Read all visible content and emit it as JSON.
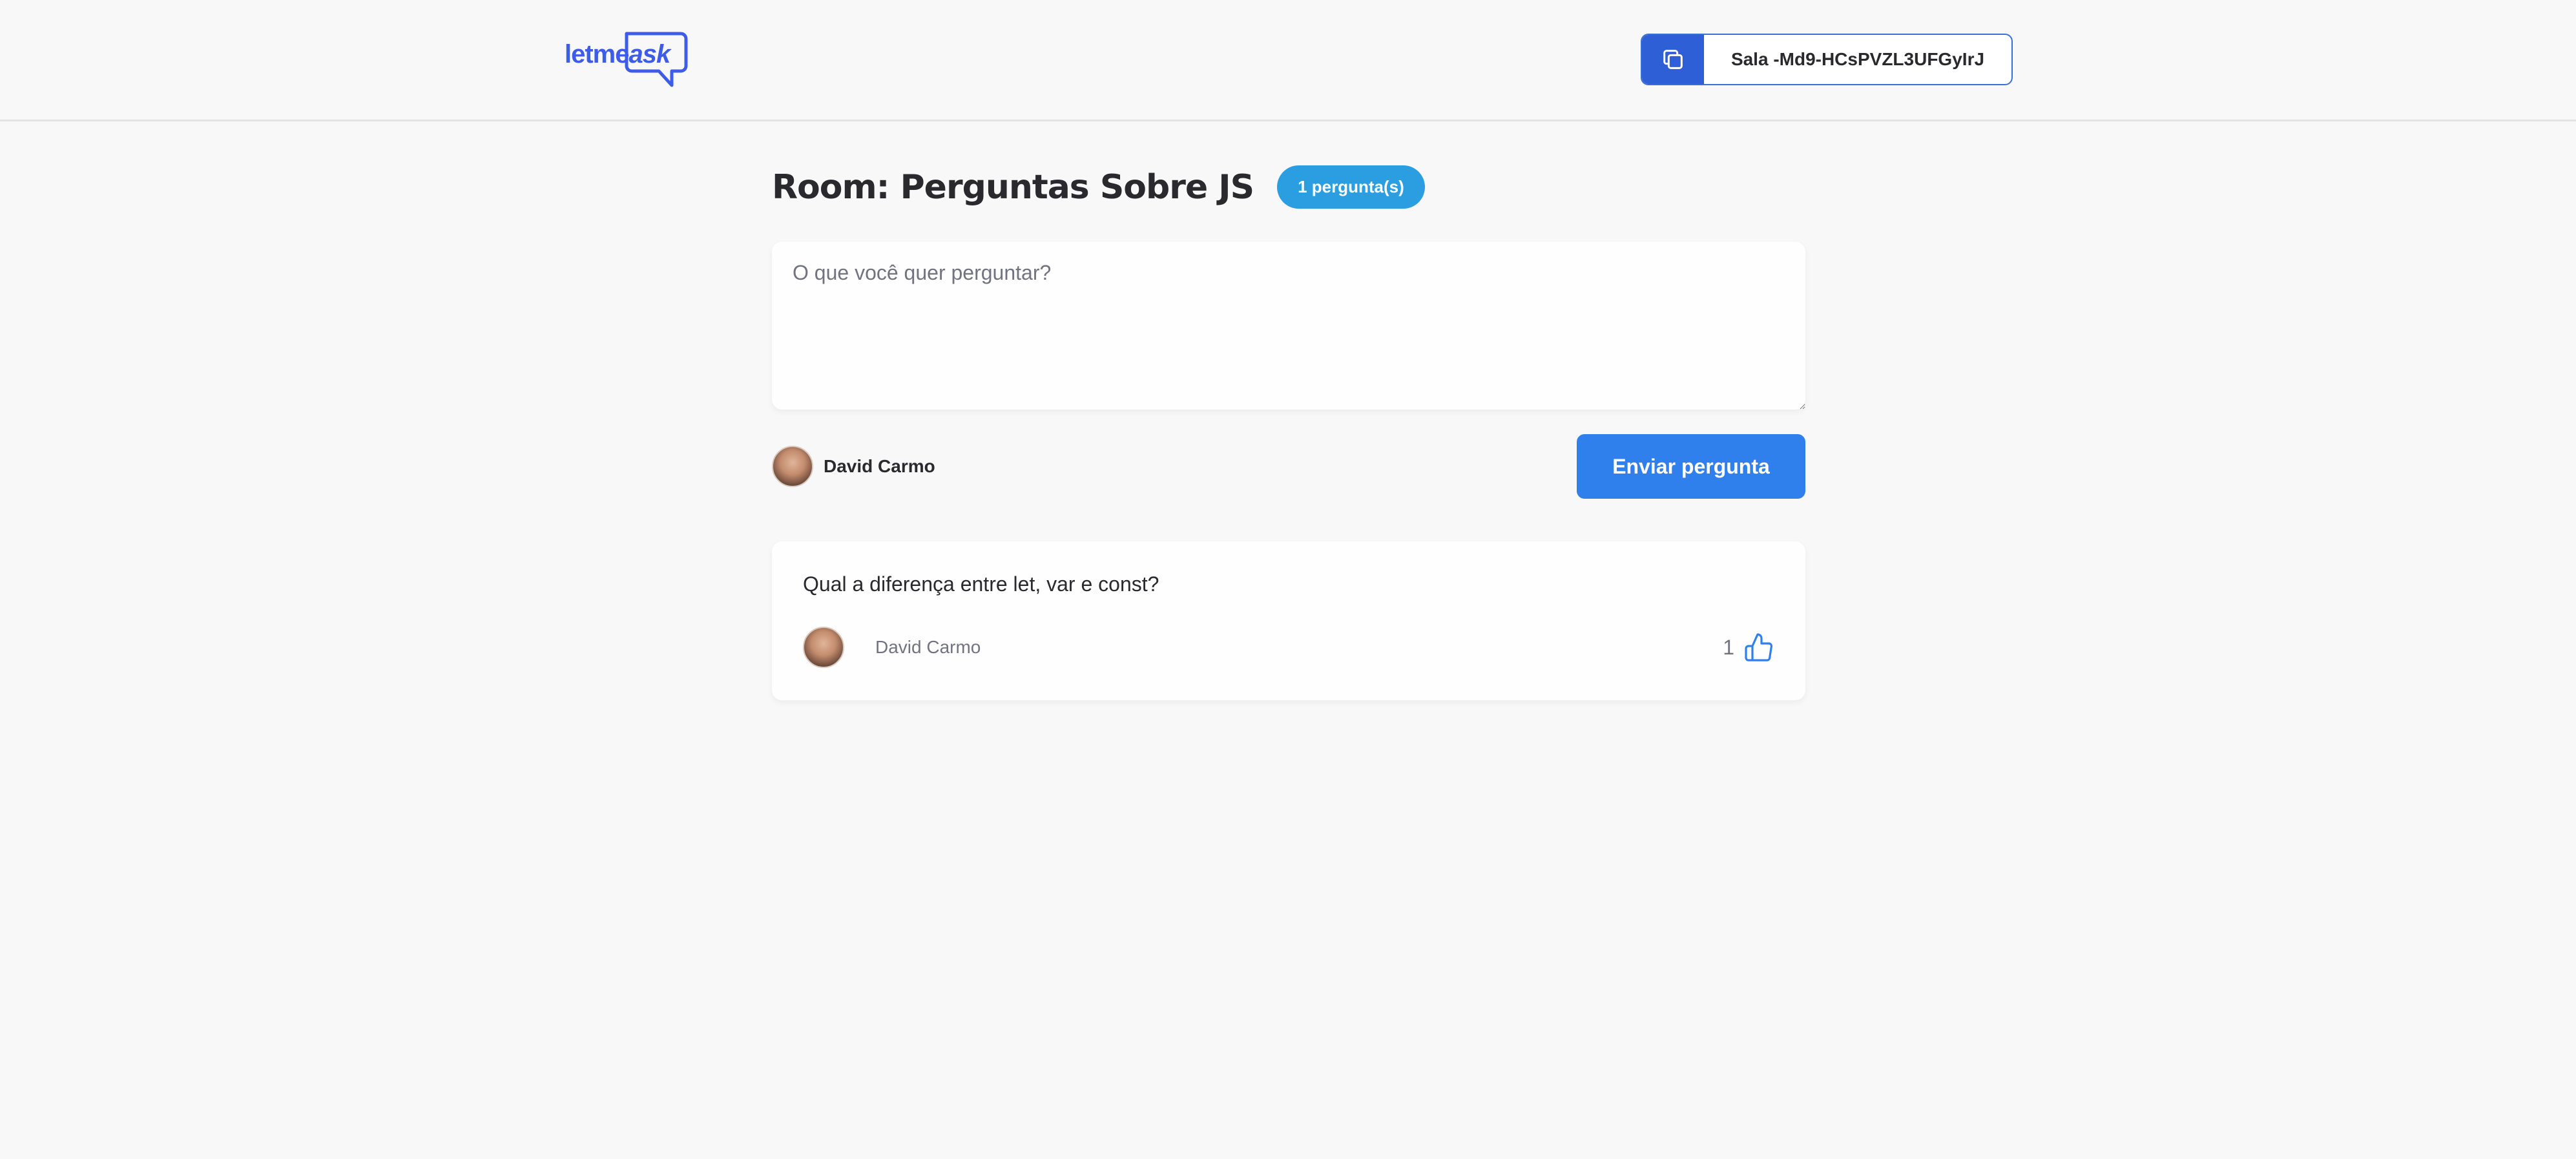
{
  "header": {
    "logo": {
      "text_main": "letme",
      "text_accent": "ask"
    },
    "room_code": {
      "label": "Sala -Md9-HCsPVZL3UFGyIrJ",
      "icon": "copy-icon"
    }
  },
  "room": {
    "title": "Room: Perguntas Sobre JS",
    "question_count_badge": "1 pergunta(s)"
  },
  "question_form": {
    "placeholder": "O que você quer perguntar?",
    "value": "",
    "user": {
      "name": "David Carmo",
      "avatar": "avatar"
    },
    "submit_label": "Enviar pergunta"
  },
  "questions": [
    {
      "content": "Qual a diferença entre let, var e const?",
      "author": "David Carmo",
      "like_count": "1",
      "like_icon": "thumbs-up-icon"
    }
  ],
  "colors": {
    "background": "#f8f8f8",
    "primary": "#2f80ed",
    "badge": "#2a9ee0",
    "copy_button": "#2f5fd6",
    "logo": "#835afd",
    "text": "#29292e",
    "muted_text": "#737380"
  }
}
